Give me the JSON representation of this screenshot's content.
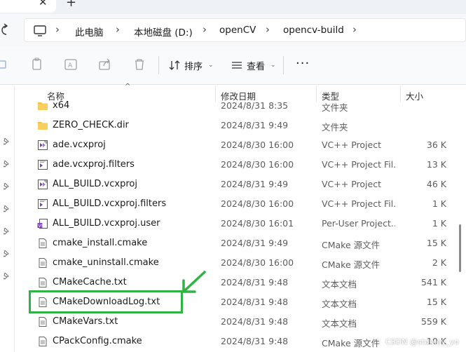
{
  "window": {
    "tab_close_glyph": "✕",
    "new_tab_glyph": "+"
  },
  "address": {
    "crumbs": [
      "此电脑",
      "本地磁盘 (D:)",
      "openCV",
      "opencv-build"
    ],
    "sep": "›"
  },
  "toolbar": {
    "sort_label": "排序",
    "view_label": "查看",
    "more_label": "···"
  },
  "columns": {
    "name": "名称",
    "date": "修改日期",
    "type": "类型",
    "size": "大小"
  },
  "files": [
    {
      "name": "x64",
      "date": "2024/8/31 8:35",
      "type": "文件夹",
      "size": "",
      "icon": "folder-icon"
    },
    {
      "name": "ZERO_CHECK.dir",
      "date": "2024/8/31 9:49",
      "type": "文件夹",
      "size": "",
      "icon": "folder-icon"
    },
    {
      "name": "ade.vcxproj",
      "date": "2024/8/30 16:00",
      "type": "VC++ Project",
      "size": "36 K",
      "icon": "vcxproj-icon"
    },
    {
      "name": "ade.vcxproj.filters",
      "date": "2024/8/30 16:00",
      "type": "VC++ Project Fil...",
      "size": "13 K",
      "icon": "vcxproj-filters-icon"
    },
    {
      "name": "ALL_BUILD.vcxproj",
      "date": "2024/8/31 9:49",
      "type": "VC++ Project",
      "size": "46 K",
      "icon": "vcxproj-icon"
    },
    {
      "name": "ALL_BUILD.vcxproj.filters",
      "date": "2024/8/30 16:00",
      "type": "VC++ Project Fil...",
      "size": "1 K",
      "icon": "vcxproj-filters-icon"
    },
    {
      "name": "ALL_BUILD.vcxproj.user",
      "date": "2024/8/30 16:01",
      "type": "Per-User Project...",
      "size": "1 K",
      "icon": "vcxproj-user-icon"
    },
    {
      "name": "cmake_install.cmake",
      "date": "2024/8/31 9:49",
      "type": "CMake 源文件",
      "size": "15 K",
      "icon": "text-file-icon"
    },
    {
      "name": "cmake_uninstall.cmake",
      "date": "2024/8/30 16:00",
      "type": "CMake 源文件",
      "size": "2 K",
      "icon": "text-file-icon"
    },
    {
      "name": "CMakeCache.txt",
      "date": "2024/8/31 9:48",
      "type": "文本文档",
      "size": "541 K",
      "icon": "text-file-icon"
    },
    {
      "name": "CMakeDownloadLog.txt",
      "date": "2024/8/31 9:48",
      "type": "文本文档",
      "size": "15 K",
      "icon": "text-file-icon"
    },
    {
      "name": "CMakeVars.txt",
      "date": "2024/8/31 9:48",
      "type": "文本文档",
      "size": "559 K",
      "icon": "text-file-icon"
    },
    {
      "name": "CPackConfig.cmake",
      "date": "2024/8/31 9:48",
      "type": "CMake 源文件",
      "size": "10 K",
      "icon": "text-file-icon"
    }
  ],
  "watermark": "CSDN @stanley_yo",
  "colors": {
    "highlight": "#2fb344",
    "folder": "#f5c244"
  }
}
